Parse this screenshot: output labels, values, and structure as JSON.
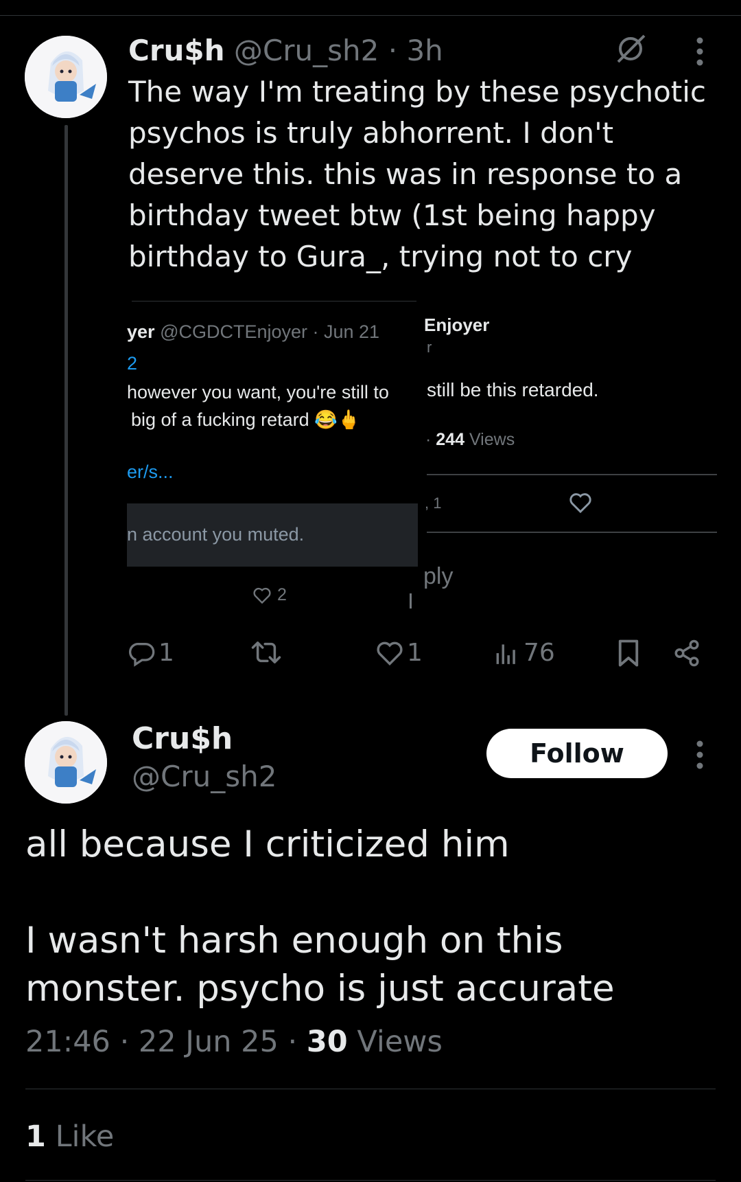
{
  "tweet1": {
    "name": "Cru$h",
    "handle": "@Cru_sh2",
    "dot": "·",
    "time": "3h",
    "text": "The way I'm treating by these psychotic psychos is truly abhorrent. I don't deserve this. this was in response to a birthday tweet btw (1st being happy birthday to Gura_, trying not to cry",
    "actions": {
      "replies": "1",
      "likes": "1",
      "views": "76"
    }
  },
  "embed": {
    "left": {
      "name_fragment": "yer",
      "handle_date": "@CGDCTEnjoyer · Jun 21",
      "reply_fragment": "2",
      "text_line1": "however you want, you're still to",
      "text_line2": "big of a fucking retard 😂🖕",
      "link_fragment": "er/s...",
      "muted_notice": "n account you muted.",
      "like_count": "2"
    },
    "right": {
      "name_fragment": "Enjoyer",
      "handle_fragment": "r",
      "text": "still be this retarded.",
      "views_prefix": "·",
      "views_count": "244",
      "views_label": "Views",
      "reply_count_fragment": ", 1",
      "reply_prompt_fragment": "ply"
    }
  },
  "tweet2": {
    "name": "Cru$h",
    "handle": "@Cru_sh2",
    "follow_label": "Follow",
    "text": "all because I criticized him\n\nI wasn't harsh enough on this monster. psycho is just accurate",
    "time": "21:46 · 22 Jun 25 · ",
    "views_count": "30",
    "views_label": "Views",
    "like_count": "1",
    "like_label": "Like"
  },
  "colors": {
    "background": "#000000",
    "text": "#e7e9ea",
    "muted": "#71767b",
    "divider": "#2f3336",
    "link": "#1d9bf0"
  }
}
